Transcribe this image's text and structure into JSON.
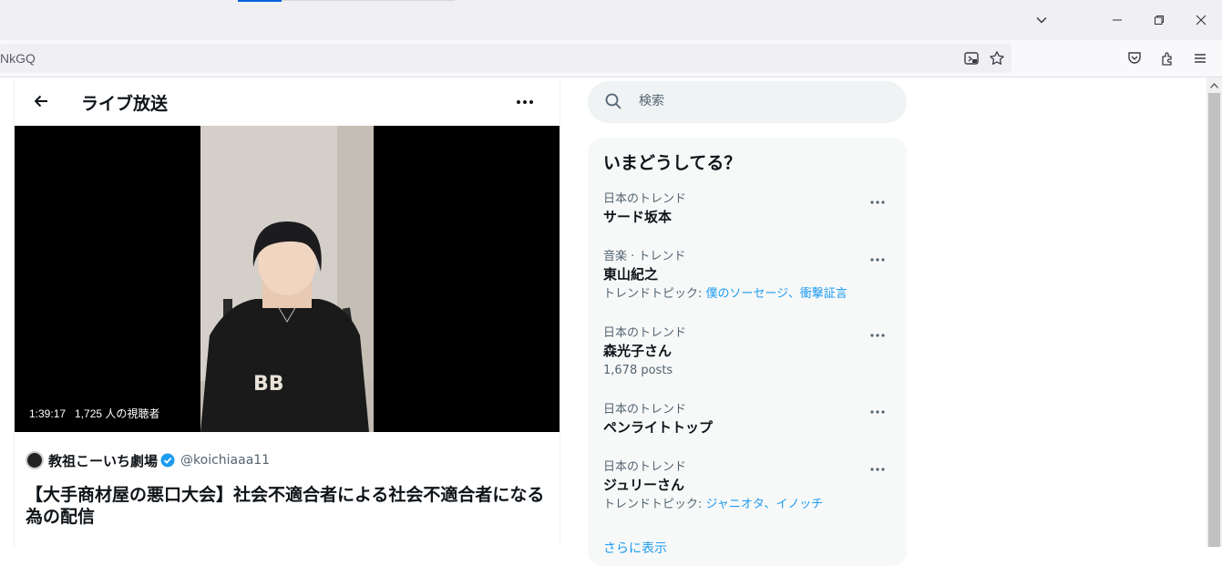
{
  "browser": {
    "url_fragment": "NkGQ"
  },
  "header": {
    "title": "ライブ放送"
  },
  "video": {
    "elapsed": "1:39:17",
    "viewers": "1,725 人の視聴者"
  },
  "broadcast": {
    "author_name": "教祖こーいち劇場",
    "author_handle": "@koichiaaa11",
    "title": "【大手商材屋の悪口大会】社会不適合者による社会不適合者になる為の配信"
  },
  "search": {
    "placeholder": "検索"
  },
  "trends": {
    "heading": "いまどうしてる？",
    "items": [
      {
        "meta": "日本のトレンド",
        "name": "サード坂本"
      },
      {
        "meta": "音楽 · トレンド",
        "name": "東山紀之",
        "topic_label": "トレンドトピック:",
        "topics": "僕のソーセージ、衝撃証言"
      },
      {
        "meta": "日本のトレンド",
        "name": "森光子さん",
        "posts": "1,678 posts"
      },
      {
        "meta": "日本のトレンド",
        "name": "ペンライトトップ"
      },
      {
        "meta": "日本のトレンド",
        "name": "ジュリーさん",
        "topic_label": "トレンドトピック:",
        "topics": "ジャニオタ、イノッチ"
      }
    ],
    "show_more": "さらに表示"
  },
  "colors": {
    "accent": "#1d9bf0",
    "muted": "#536471",
    "panel": "#f7f9f9"
  }
}
